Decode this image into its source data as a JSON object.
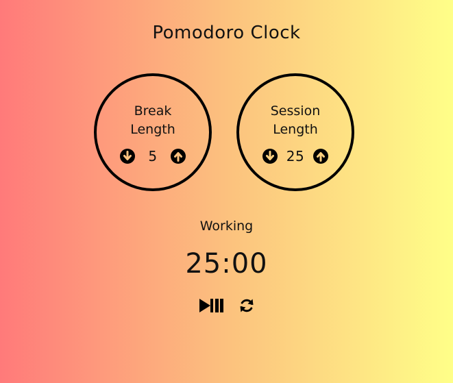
{
  "app": {
    "title": "Pomodoro Clock"
  },
  "break": {
    "label": "Break\nLength",
    "value": "5",
    "decrement_icon": "arrow-circle-down-icon",
    "increment_icon": "arrow-circle-up-icon"
  },
  "session": {
    "label": "Session\nLength",
    "value": "25",
    "decrement_icon": "arrow-circle-down-icon",
    "increment_icon": "arrow-circle-up-icon"
  },
  "timer": {
    "status": "Working",
    "time": "25:00",
    "play_pause_icon": "play-pause-icon",
    "reset_icon": "refresh-icon"
  },
  "colors": {
    "gradient_left": "#ff7a7a",
    "gradient_mid": "#fcc17e",
    "gradient_right": "#ffff88",
    "foreground": "#000000"
  }
}
